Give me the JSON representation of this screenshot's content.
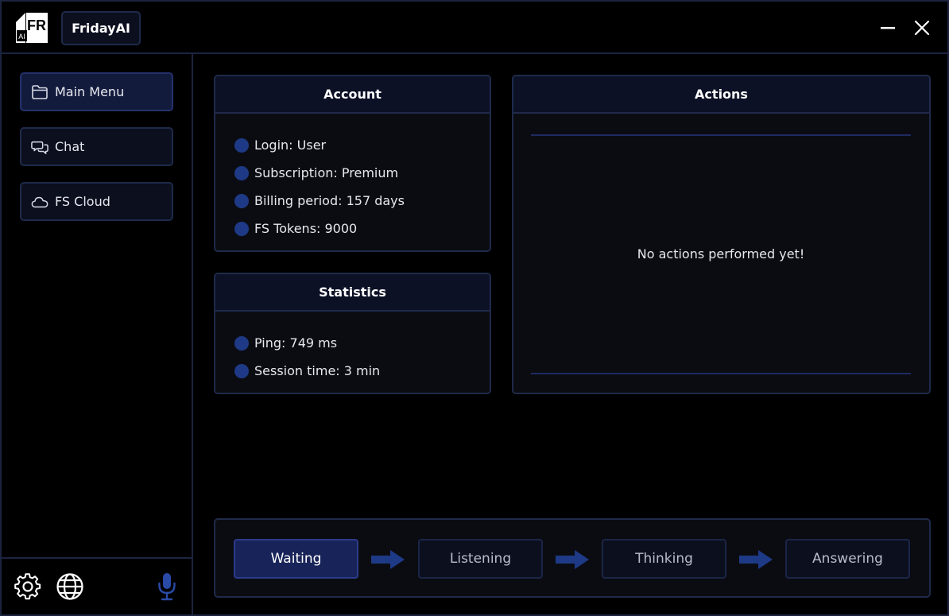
{
  "app": {
    "logo_text": "FR",
    "logo_sub": "AI",
    "title": "FridayAI"
  },
  "sidebar": {
    "items": [
      {
        "label": "Main Menu",
        "icon": "folder-icon",
        "active": true
      },
      {
        "label": "Chat",
        "icon": "chat-icon",
        "active": false
      },
      {
        "label": "FS Cloud",
        "icon": "cloud-icon",
        "active": false
      }
    ],
    "bottom_icons": [
      "gear-icon",
      "globe-icon",
      "microphone-icon"
    ]
  },
  "account": {
    "title": "Account",
    "rows": [
      "Login: User",
      "Subscription: Premium",
      "Billing period: 157 days",
      "FS Tokens: 9000"
    ]
  },
  "statistics": {
    "title": "Statistics",
    "rows": [
      "Ping: 749 ms",
      "Session time: 3 min"
    ]
  },
  "actions": {
    "title": "Actions",
    "empty_text": "No actions performed yet!"
  },
  "pipeline": {
    "stages": [
      {
        "label": "Waiting",
        "active": true
      },
      {
        "label": "Listening",
        "active": false
      },
      {
        "label": "Thinking",
        "active": false
      },
      {
        "label": "Answering",
        "active": false
      }
    ]
  },
  "colors": {
    "background": "#000000",
    "border": "#1f2a4a",
    "accent": "#1e3a86",
    "active": "#182459",
    "mic": "#2a4aa8"
  }
}
